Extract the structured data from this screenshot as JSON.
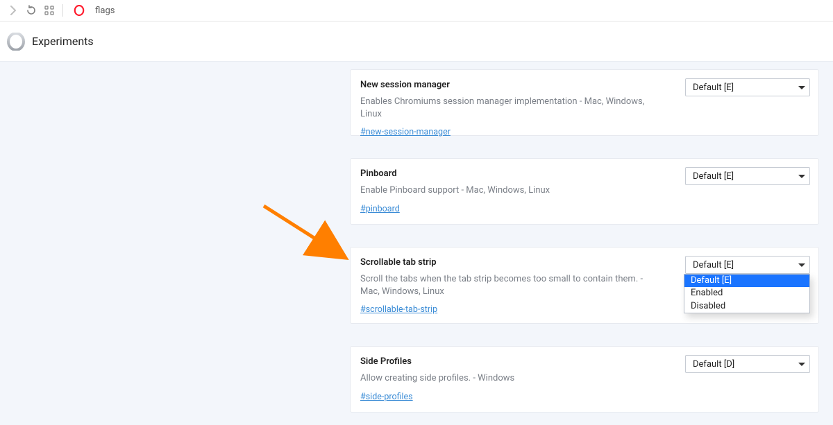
{
  "browser": {
    "address": "flags"
  },
  "header": {
    "title": "Experiments"
  },
  "cards": {
    "c1": {
      "title": "New session manager",
      "desc": "Enables Chromiums session manager implementation ‑ Mac, Windows, Linux",
      "link": "#new-session-manager",
      "selected": "Default [E]"
    },
    "c2": {
      "title": "Pinboard",
      "desc": "Enable Pinboard support ‑ Mac, Windows, Linux",
      "link": "#pinboard",
      "selected": "Default [E]"
    },
    "c3": {
      "title": "Scrollable tab strip",
      "desc": "Scroll the tabs when the tab strip becomes too small to contain them. ‑ Mac, Windows, Linux",
      "link": "#scrollable-tab-strip",
      "selected": "Default [E]",
      "options": {
        "o1": "Default [E]",
        "o2": "Enabled",
        "o3": "Disabled"
      }
    },
    "c4": {
      "title": "Side Profiles",
      "desc": "Allow creating side profiles. ‑ Windows",
      "link": "#side-profiles",
      "selected": "Default [D]"
    }
  }
}
